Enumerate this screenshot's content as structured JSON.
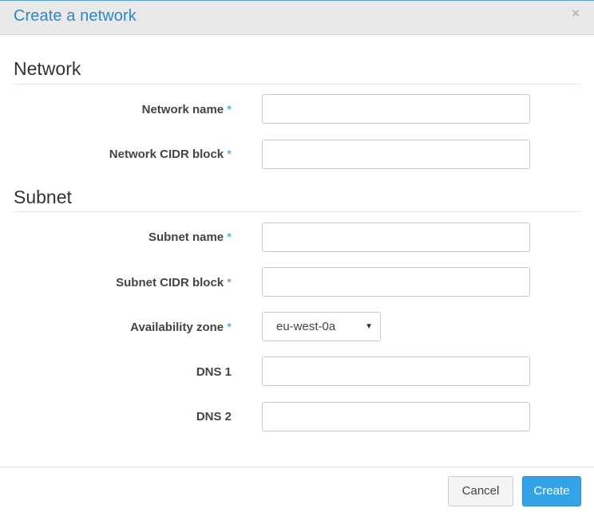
{
  "dialog": {
    "title": "Create a network",
    "close_glyph": "×"
  },
  "network_section": {
    "heading": "Network",
    "fields": {
      "network_name": {
        "label": "Network name",
        "required_marker": "*",
        "value": ""
      },
      "network_cidr": {
        "label": "Network CIDR block",
        "required_marker": "*",
        "value": ""
      }
    }
  },
  "subnet_section": {
    "heading": "Subnet",
    "fields": {
      "subnet_name": {
        "label": "Subnet name",
        "required_marker": "*",
        "value": ""
      },
      "subnet_cidr": {
        "label": "Subnet CIDR block",
        "required_marker": "*",
        "value": ""
      },
      "availability_zone": {
        "label": "Availability zone",
        "required_marker": "*",
        "selected": "eu-west-0a"
      },
      "dns1": {
        "label": "DNS 1",
        "value": ""
      },
      "dns2": {
        "label": "DNS 2",
        "value": ""
      }
    }
  },
  "footer": {
    "cancel_label": "Cancel",
    "create_label": "Create"
  },
  "colors": {
    "title_blue": "#2b88c8",
    "required_blue": "#2b9fd8",
    "primary_button": "#35a3e8",
    "header_bg": "#e9e9e9"
  },
  "icons": {
    "close": "close-icon",
    "select_caret": "caret-down-icon"
  }
}
